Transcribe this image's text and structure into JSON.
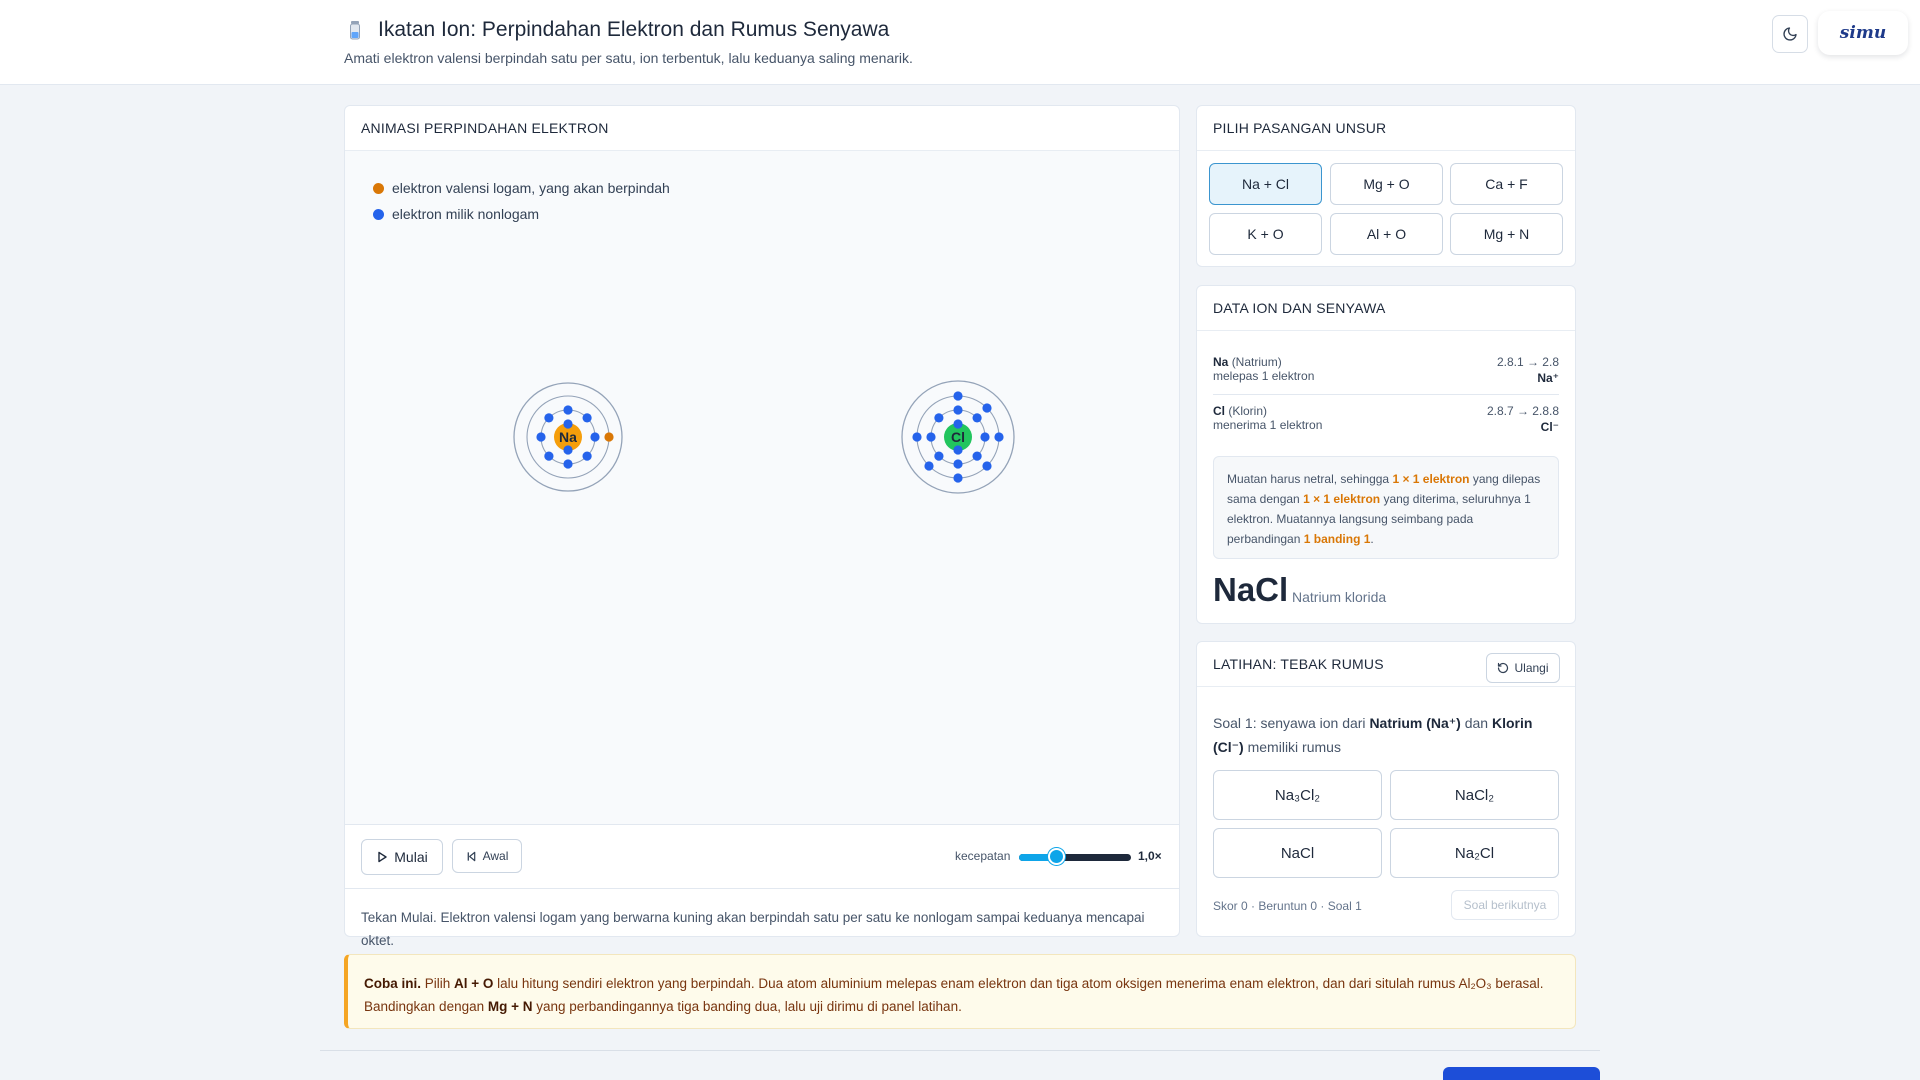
{
  "header": {
    "title": "Ikatan Ion: Perpindahan Elektron dan Rumus Senyawa",
    "subtitle": "Amati elektron valensi berpindah satu per satu, ion terbentuk, lalu keduanya saling menarik.",
    "logo": "simu"
  },
  "animation": {
    "heading": "ANIMASI PERPINDAHAN ELEKTRON",
    "legend": [
      {
        "label": "elektron valensi logam, yang akan berpindah",
        "color": "#d97706"
      },
      {
        "label": "elektron milik nonlogam",
        "color": "#2563eb"
      }
    ],
    "atoms": [
      {
        "symbol": "Na",
        "color": "#f59e0b",
        "shells": [
          2,
          8,
          1
        ]
      },
      {
        "symbol": "Cl",
        "color": "#22c55e",
        "shells": [
          2,
          8,
          7
        ]
      }
    ],
    "controls": {
      "start_label": "Mulai",
      "reset_label": "Awal",
      "speed_label": "kecepatan",
      "speed_value_text": "1,0×",
      "speed_fraction": 0.3
    },
    "narration": "Tekan Mulai. Elektron valensi logam yang berwarna kuning akan berpindah satu per satu ke nonlogam sampai keduanya mencapai oktet."
  },
  "pairs": {
    "heading": "PILIH PASANGAN UNSUR",
    "items": [
      "Na + Cl",
      "Mg + O",
      "Ca + F",
      "K + O",
      "Al + O",
      "Mg + N"
    ],
    "selected": "Na + Cl"
  },
  "ion_data": {
    "heading": "DATA ION DAN SENYAWA",
    "metal": {
      "symbol": "Na",
      "name": "(Natrium)",
      "action": "melepas 1 elektron",
      "config": "2.8.1 → 2.8",
      "ion": "Na⁺"
    },
    "nonmetal": {
      "symbol": "Cl",
      "name": "(Klorin)",
      "action": "menerima 1 elektron",
      "config": "2.8.7 → 2.8.8",
      "ion": "Cl⁻"
    },
    "note": {
      "p1": "Muatan harus netral, sehingga ",
      "h1": "1 × 1 elektron",
      "p2": " yang dilepas sama dengan ",
      "h2": "1 × 1 elektron",
      "p3": " yang diterima, seluruhnya 1 elektron. Muatannya langsung seimbang pada perbandingan ",
      "h3": "1 banding 1",
      "p4": "."
    },
    "formula": "NaCl",
    "formula_name": "Natrium klorida"
  },
  "quiz": {
    "heading": "LATIHAN: TEBAK RUMUS",
    "reset_label": "Ulangi",
    "q_prefix": "Soal 1: senyawa ion dari ",
    "q_metal": "Natrium (Na⁺)",
    "q_mid": " dan ",
    "q_nonmetal": "Klorin (Cl⁻)",
    "q_suffix": " memiliki rumus",
    "answers": [
      "Na₃Cl₂",
      "NaCl₂",
      "NaCl",
      "Na₂Cl"
    ],
    "score_text": "Skor 0 · Beruntun 0 · Soal 1",
    "next_label": "Soal berikutnya"
  },
  "tip": {
    "lead": "Coba ini.",
    "t1": " Pilih ",
    "b1": "Al + O",
    "t2": " lalu hitung sendiri elektron yang berpindah. Dua atom aluminium melepas enam elektron dan tiga atom oksigen menerima enam elektron, dan dari situlah rumus Al₂O₃ berasal. Bandingkan dengan ",
    "b2": "Mg + N",
    "t3": " yang perbandingannya tiga banding dua, lalu uji dirimu di panel latihan."
  },
  "colors": {
    "metal_electron": "#d97706",
    "nonmetal_electron": "#2563eb",
    "accent": "#0ea5e9",
    "highlight": "#d97706"
  }
}
